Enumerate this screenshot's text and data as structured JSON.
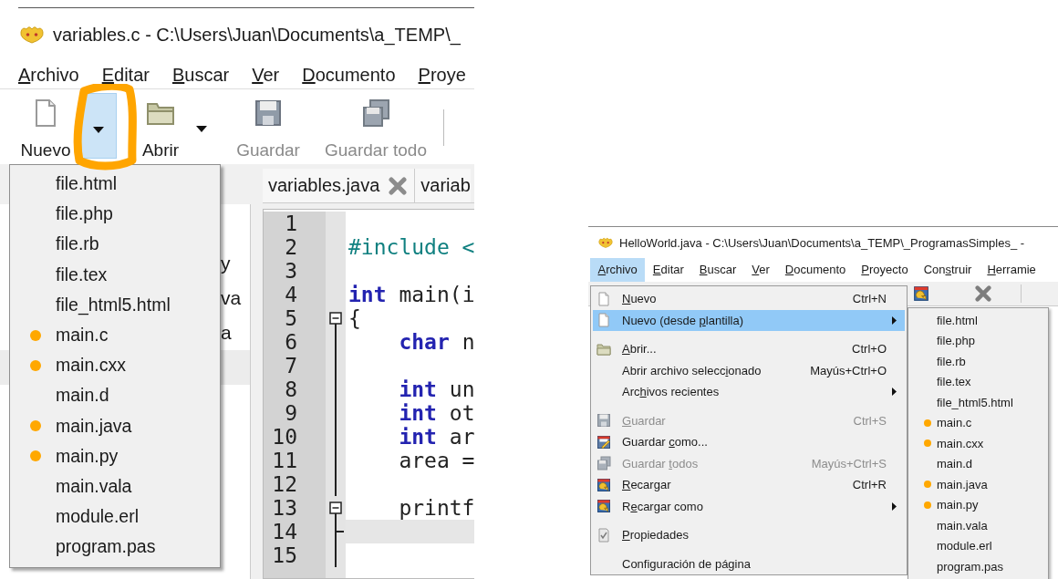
{
  "left": {
    "title": "variables.c - C:\\Users\\Juan\\Documents\\a_TEMP\\_",
    "menu_bar": [
      {
        "label": {
          "key": "A",
          "after": "rchivo"
        }
      },
      {
        "label": {
          "key": "E",
          "after": "ditar"
        }
      },
      {
        "label": {
          "key": "B",
          "after": "uscar"
        }
      },
      {
        "label": {
          "key": "V",
          "after": "er"
        }
      },
      {
        "label": {
          "key": "D",
          "after": "ocumento"
        }
      },
      {
        "label": {
          "key": "P",
          "after": "roye"
        }
      }
    ],
    "toolbar": [
      {
        "kind": "new",
        "label": "Nuevo",
        "disabled": false
      },
      {
        "kind": "dropdown",
        "selected": true
      },
      {
        "kind": "open",
        "label": "Abrir",
        "disabled": false
      },
      {
        "kind": "dropdown",
        "selected": false
      },
      {
        "kind": "save",
        "label": "Guardar",
        "disabled": true
      },
      {
        "kind": "save-all",
        "label": "Guardar todo",
        "disabled": true
      },
      {
        "kind": "separator"
      }
    ],
    "highlight_ring": true,
    "template_menu": [
      {
        "label": "file.html",
        "marked": false
      },
      {
        "label": "file.php",
        "marked": false
      },
      {
        "label": "file.rb",
        "marked": false
      },
      {
        "label": "file.tex",
        "marked": false
      },
      {
        "label": "file_html5.html",
        "marked": false
      },
      {
        "label": "main.c",
        "marked": true
      },
      {
        "label": "main.cxx",
        "marked": true
      },
      {
        "label": "main.d",
        "marked": false
      },
      {
        "label": "main.java",
        "marked": true
      },
      {
        "label": "main.py",
        "marked": true
      },
      {
        "label": "main.vala",
        "marked": false
      },
      {
        "label": "module.erl",
        "marked": false
      },
      {
        "label": "program.pas",
        "marked": false
      }
    ],
    "sidebar": {
      "items": [
        {
          "text": "y",
          "selected": false
        },
        {
          "text": "va",
          "selected": false
        },
        {
          "text": "a",
          "selected": false
        },
        {
          "selected": true
        }
      ]
    },
    "tabs": [
      {
        "label": "variables.java",
        "close_button": true
      },
      {
        "label": "variab",
        "close_button": false
      }
    ],
    "editor": {
      "lines": [
        {
          "number": "1",
          "kind": "plain",
          "current": false
        },
        {
          "number": "2",
          "kind": "plain",
          "current": false,
          "code": [
            {
              "kind": "preproc",
              "text": "#include <"
            }
          ]
        },
        {
          "number": "3",
          "kind": "plain",
          "current": false
        },
        {
          "number": "4",
          "kind": "plain",
          "current": false,
          "code": [
            {
              "kind": "keyword",
              "text": "int"
            },
            {
              "kind": "plain",
              "text": " main(i"
            }
          ]
        },
        {
          "number": "5",
          "kind": "fold-start",
          "current": false,
          "code": [
            {
              "kind": "plain",
              "text": "{"
            }
          ]
        },
        {
          "number": "6",
          "kind": "fold-body",
          "current": false,
          "code": [
            {
              "kind": "keyword",
              "text": "    char"
            },
            {
              "kind": "plain",
              "text": " n"
            }
          ]
        },
        {
          "number": "7",
          "kind": "fold-body",
          "current": false
        },
        {
          "number": "8",
          "kind": "fold-body",
          "current": false,
          "code": [
            {
              "kind": "keyword",
              "text": "    int"
            },
            {
              "kind": "plain",
              "text": " un"
            }
          ]
        },
        {
          "number": "9",
          "kind": "fold-body",
          "current": false,
          "code": [
            {
              "kind": "keyword",
              "text": "    int"
            },
            {
              "kind": "plain",
              "text": " ot"
            }
          ]
        },
        {
          "number": "10",
          "kind": "fold-body",
          "current": false,
          "code": [
            {
              "kind": "keyword",
              "text": "    int"
            },
            {
              "kind": "plain",
              "text": " ar"
            }
          ]
        },
        {
          "number": "11",
          "kind": "fold-body",
          "current": false,
          "code": [
            {
              "kind": "plain",
              "text": "    area ="
            }
          ]
        },
        {
          "number": "12",
          "kind": "fold-body",
          "current": false
        },
        {
          "number": "13",
          "kind": "fold-start",
          "current": false,
          "code": [
            {
              "kind": "plain",
              "text": "    printf"
            }
          ]
        },
        {
          "number": "14",
          "kind": "fold-end",
          "current": true
        },
        {
          "number": "15",
          "kind": "fold-body",
          "current": false
        }
      ]
    }
  },
  "right": {
    "title": "HelloWorld.java - C:\\Users\\Juan\\Documents\\a_TEMP\\_ProgramasSimples_ -",
    "menu_bar": [
      {
        "label": {
          "key": "A",
          "after": "rchivo"
        },
        "selected": true
      },
      {
        "label": {
          "key": "E",
          "after": "ditar"
        },
        "selected": false
      },
      {
        "label": {
          "key": "B",
          "after": "uscar"
        },
        "selected": false
      },
      {
        "label": {
          "key": "V",
          "after": "er"
        },
        "selected": false
      },
      {
        "label": {
          "key": "D",
          "after": "ocumento"
        },
        "selected": false
      },
      {
        "label": {
          "key": "P",
          "after": "royecto"
        },
        "selected": false
      },
      {
        "label": {
          "before": "Con",
          "key": "s",
          "after": "truir"
        },
        "selected": false
      },
      {
        "label": {
          "key": "H",
          "after": "erramie"
        },
        "selected": false
      }
    ],
    "file_menu": [
      {
        "kind": "new",
        "label": {
          "key": "N",
          "after": "uevo"
        },
        "shortcut": "Ctrl+N",
        "submenu": false,
        "disabled": false,
        "selected": false
      },
      {
        "kind": "new",
        "label": {
          "before": "Nuevo (desde ",
          "key": "p",
          "after": "lantilla)"
        },
        "submenu": true,
        "disabled": false,
        "selected": true
      },
      {
        "kind": "separator"
      },
      {
        "kind": "open",
        "label": {
          "key": "A",
          "after": "brir..."
        },
        "shortcut": "Ctrl+O",
        "submenu": false,
        "disabled": false,
        "selected": false
      },
      {
        "kind": "plain",
        "label": {
          "before": "Abrir archivo selecc",
          "key": "i",
          "after": "onado"
        },
        "shortcut": "Mayús+Ctrl+O",
        "submenu": false,
        "disabled": false,
        "selected": false
      },
      {
        "kind": "plain",
        "label": {
          "before": "Arc",
          "key": "h",
          "after": "ivos recientes"
        },
        "submenu": true,
        "disabled": false,
        "selected": false
      },
      {
        "kind": "separator"
      },
      {
        "kind": "save",
        "label": {
          "key": "G",
          "after": "uardar"
        },
        "shortcut": "Ctrl+S",
        "submenu": false,
        "disabled": true,
        "selected": false
      },
      {
        "kind": "save-as",
        "label": {
          "before": "Guardar ",
          "key": "c",
          "after": "omo..."
        },
        "submenu": false,
        "disabled": false,
        "selected": false
      },
      {
        "kind": "save-all",
        "label": {
          "before": "Guardar ",
          "key": "t",
          "after": "odos"
        },
        "shortcut": "Mayús+Ctrl+S",
        "submenu": false,
        "disabled": true,
        "selected": false
      },
      {
        "kind": "reload",
        "label": {
          "key": "R",
          "after": "ecargar"
        },
        "shortcut": "Ctrl+R",
        "submenu": false,
        "disabled": false,
        "selected": false
      },
      {
        "kind": "reload",
        "label": {
          "before": "R",
          "key": "e",
          "after": "cargar como"
        },
        "submenu": true,
        "disabled": false,
        "selected": false
      },
      {
        "kind": "separator"
      },
      {
        "kind": "properties",
        "label": {
          "key": "P",
          "after": "ropiedades"
        },
        "submenu": false,
        "disabled": false,
        "selected": false
      },
      {
        "kind": "separator"
      },
      {
        "kind": "plain",
        "label": {
          "before": "Configuración de página"
        },
        "submenu": false,
        "disabled": false,
        "selected": false
      }
    ],
    "template_submenu": [
      {
        "label": "file.html",
        "marked": false
      },
      {
        "label": "file.php",
        "marked": false
      },
      {
        "label": "file.rb",
        "marked": false
      },
      {
        "label": "file.tex",
        "marked": false
      },
      {
        "label": "file_html5.html",
        "marked": false
      },
      {
        "label": "main.c",
        "marked": true
      },
      {
        "label": "main.cxx",
        "marked": true
      },
      {
        "label": "main.d",
        "marked": false
      },
      {
        "label": "main.java",
        "marked": true
      },
      {
        "label": "main.py",
        "marked": true
      },
      {
        "label": "main.vala",
        "marked": false
      },
      {
        "label": "module.erl",
        "marked": false
      },
      {
        "label": "program.pas",
        "marked": false
      }
    ]
  }
}
